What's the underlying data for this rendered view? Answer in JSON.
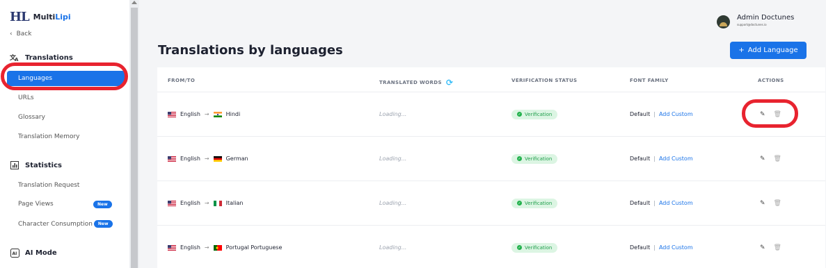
{
  "app": {
    "logo_mark": "HL",
    "name_part1": "Multi",
    "name_part2": "Lipi"
  },
  "sidebar": {
    "back_label": "Back",
    "translations_heading": "Translations",
    "items": [
      {
        "label": "Languages",
        "active": true
      },
      {
        "label": "URLs"
      },
      {
        "label": "Glossary"
      },
      {
        "label": "Translation Memory"
      }
    ],
    "statistics_heading": "Statistics",
    "stats_items": [
      {
        "label": "Translation Request"
      },
      {
        "label": "Page Views",
        "badge": "New"
      },
      {
        "label": "Character Consumption",
        "badge": "New"
      }
    ],
    "ai_heading": "AI Mode"
  },
  "user": {
    "name": "Admin Doctunes",
    "email": "support@doctunes.io"
  },
  "page": {
    "title": "Translations by languages",
    "add_button": "Add Language",
    "add_button_icon": "+"
  },
  "table": {
    "columns": {
      "from_to": "FROM/TO",
      "translated_words": "TRANSLATED WORDS",
      "verification_status": "VERIFICATION STATUS",
      "font_family": "FONT FAMILY",
      "actions": "ACTIONS"
    },
    "rows": [
      {
        "from": "English",
        "to": "Hindi",
        "words": "Loading...",
        "status": "Verification",
        "font": "Default",
        "font_link": "Add Custom",
        "flag_to": "in"
      },
      {
        "from": "English",
        "to": "German",
        "words": "Loading...",
        "status": "Verification",
        "font": "Default",
        "font_link": "Add Custom",
        "flag_to": "de"
      },
      {
        "from": "English",
        "to": "Italian",
        "words": "Loading...",
        "status": "Verification",
        "font": "Default",
        "font_link": "Add Custom",
        "flag_to": "it"
      },
      {
        "from": "English",
        "to": "Portugal Portuguese",
        "words": "Loading...",
        "status": "Verification",
        "font": "Default",
        "font_link": "Add Custom",
        "flag_to": "pt"
      }
    ],
    "arrow": "→",
    "separator": "|"
  },
  "colors": {
    "accent": "#1a73e8",
    "annotation": "#e8232f",
    "verified_bg": "#dcf5e3",
    "verified_text": "#1e9e4a"
  }
}
